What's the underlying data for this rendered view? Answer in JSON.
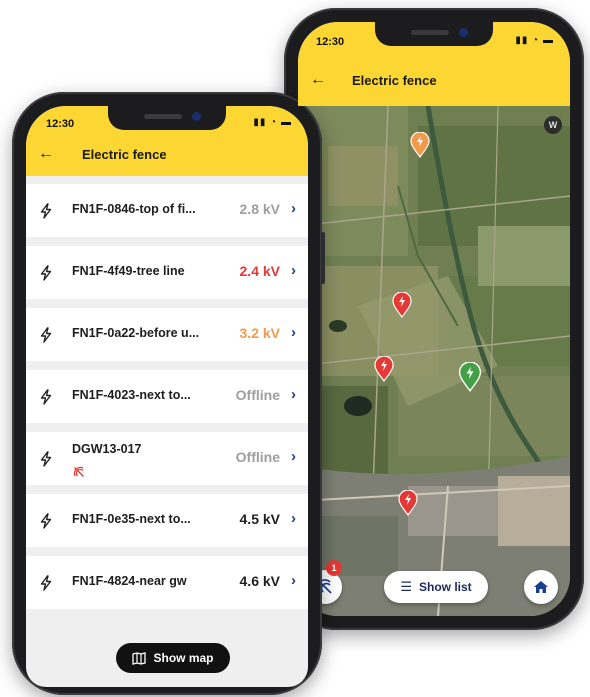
{
  "map_screen": {
    "status_time": "12:30",
    "status_icons": "▮▮ ◔ ▬",
    "title": "Electric fence",
    "compass_label": "W",
    "badge_count": "1",
    "show_list_label": "Show list"
  },
  "list_screen": {
    "status_time": "12:30",
    "status_icons": "▮▮ ◔ ▬",
    "title": "Electric fence",
    "items": [
      {
        "name": "FN1F-0846-top of fi...",
        "value": "2.8 kV",
        "color": "#9e9e9e"
      },
      {
        "name": "FN1F-4f49-tree line",
        "value": "2.4 kV",
        "color": "#e53935"
      },
      {
        "name": "FN1F-0a22-before u...",
        "value": "3.2 kV",
        "color": "#f2994a"
      },
      {
        "name": "FN1F-4023-next to...",
        "value": "Offline",
        "color": "#9e9e9e"
      },
      {
        "name": "DGW13-017",
        "value": "Offline",
        "color": "#9e9e9e",
        "offline_signal": true
      },
      {
        "name": "FN1F-0e35-next to...",
        "value": "4.5 kV",
        "color": "#1f1f1f"
      },
      {
        "name": "FN1F-4824-near gw",
        "value": "4.6 kV",
        "color": "#1f1f1f"
      }
    ],
    "show_map_label": "Show map"
  },
  "colors": {
    "header_yellow": "#fcd734",
    "pin_red": "#e53935",
    "pin_orange": "#f2994a",
    "pin_green": "#43a047",
    "link_blue": "#1b3f8f"
  }
}
